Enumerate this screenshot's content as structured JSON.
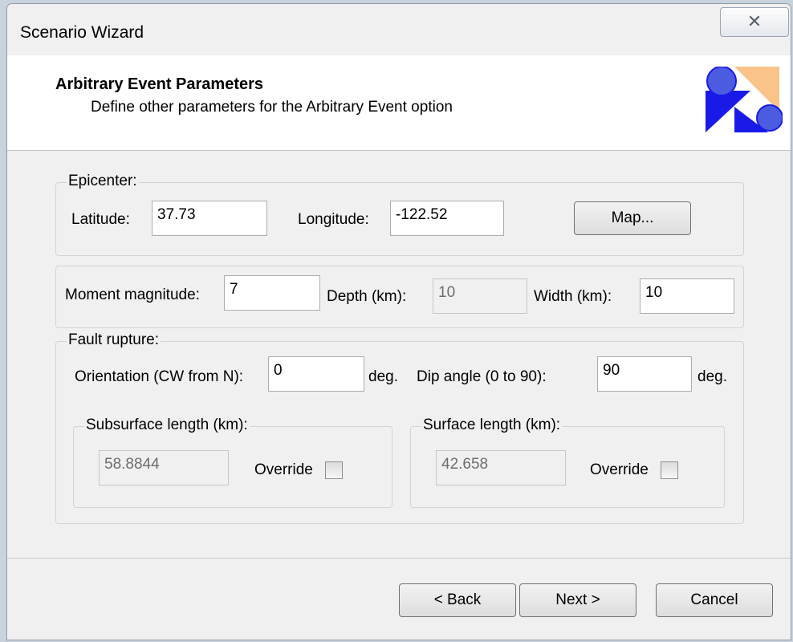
{
  "window": {
    "title": "Scenario Wizard",
    "close_glyph": "✕"
  },
  "header": {
    "title": "Arbitrary Event Parameters",
    "subtitle": "Define other parameters for the Arbitrary Event option",
    "logo_icon": "wizard-shapes-icon"
  },
  "epicenter": {
    "legend": "Epicenter:",
    "latitude_label": "Latitude:",
    "latitude_value": "37.73",
    "longitude_label": "Longitude:",
    "longitude_value": "-122.52",
    "map_button": "Map..."
  },
  "magnitude": {
    "moment_label": "Moment magnitude:",
    "moment_value": "7",
    "depth_label": "Depth (km):",
    "depth_value": "10",
    "width_label": "Width (km):",
    "width_value": "10"
  },
  "fault": {
    "legend": "Fault rupture:",
    "orientation_label": "Orientation (CW from N):",
    "orientation_value": "0",
    "orientation_unit": "deg.",
    "dip_label": "Dip angle (0 to 90):",
    "dip_value": "90",
    "dip_unit": "deg.",
    "subsurface": {
      "legend": "Subsurface length (km):",
      "value": "58.8844",
      "override_label": "Override"
    },
    "surface": {
      "legend": "Surface length (km):",
      "value": "42.658",
      "override_label": "Override"
    }
  },
  "footer": {
    "back": "< Back",
    "next": "Next >",
    "cancel": "Cancel"
  },
  "colors": {
    "logo_blue": "#1a1ae8",
    "logo_peach": "#f9c38a",
    "window_bg": "#f0f0f0"
  }
}
